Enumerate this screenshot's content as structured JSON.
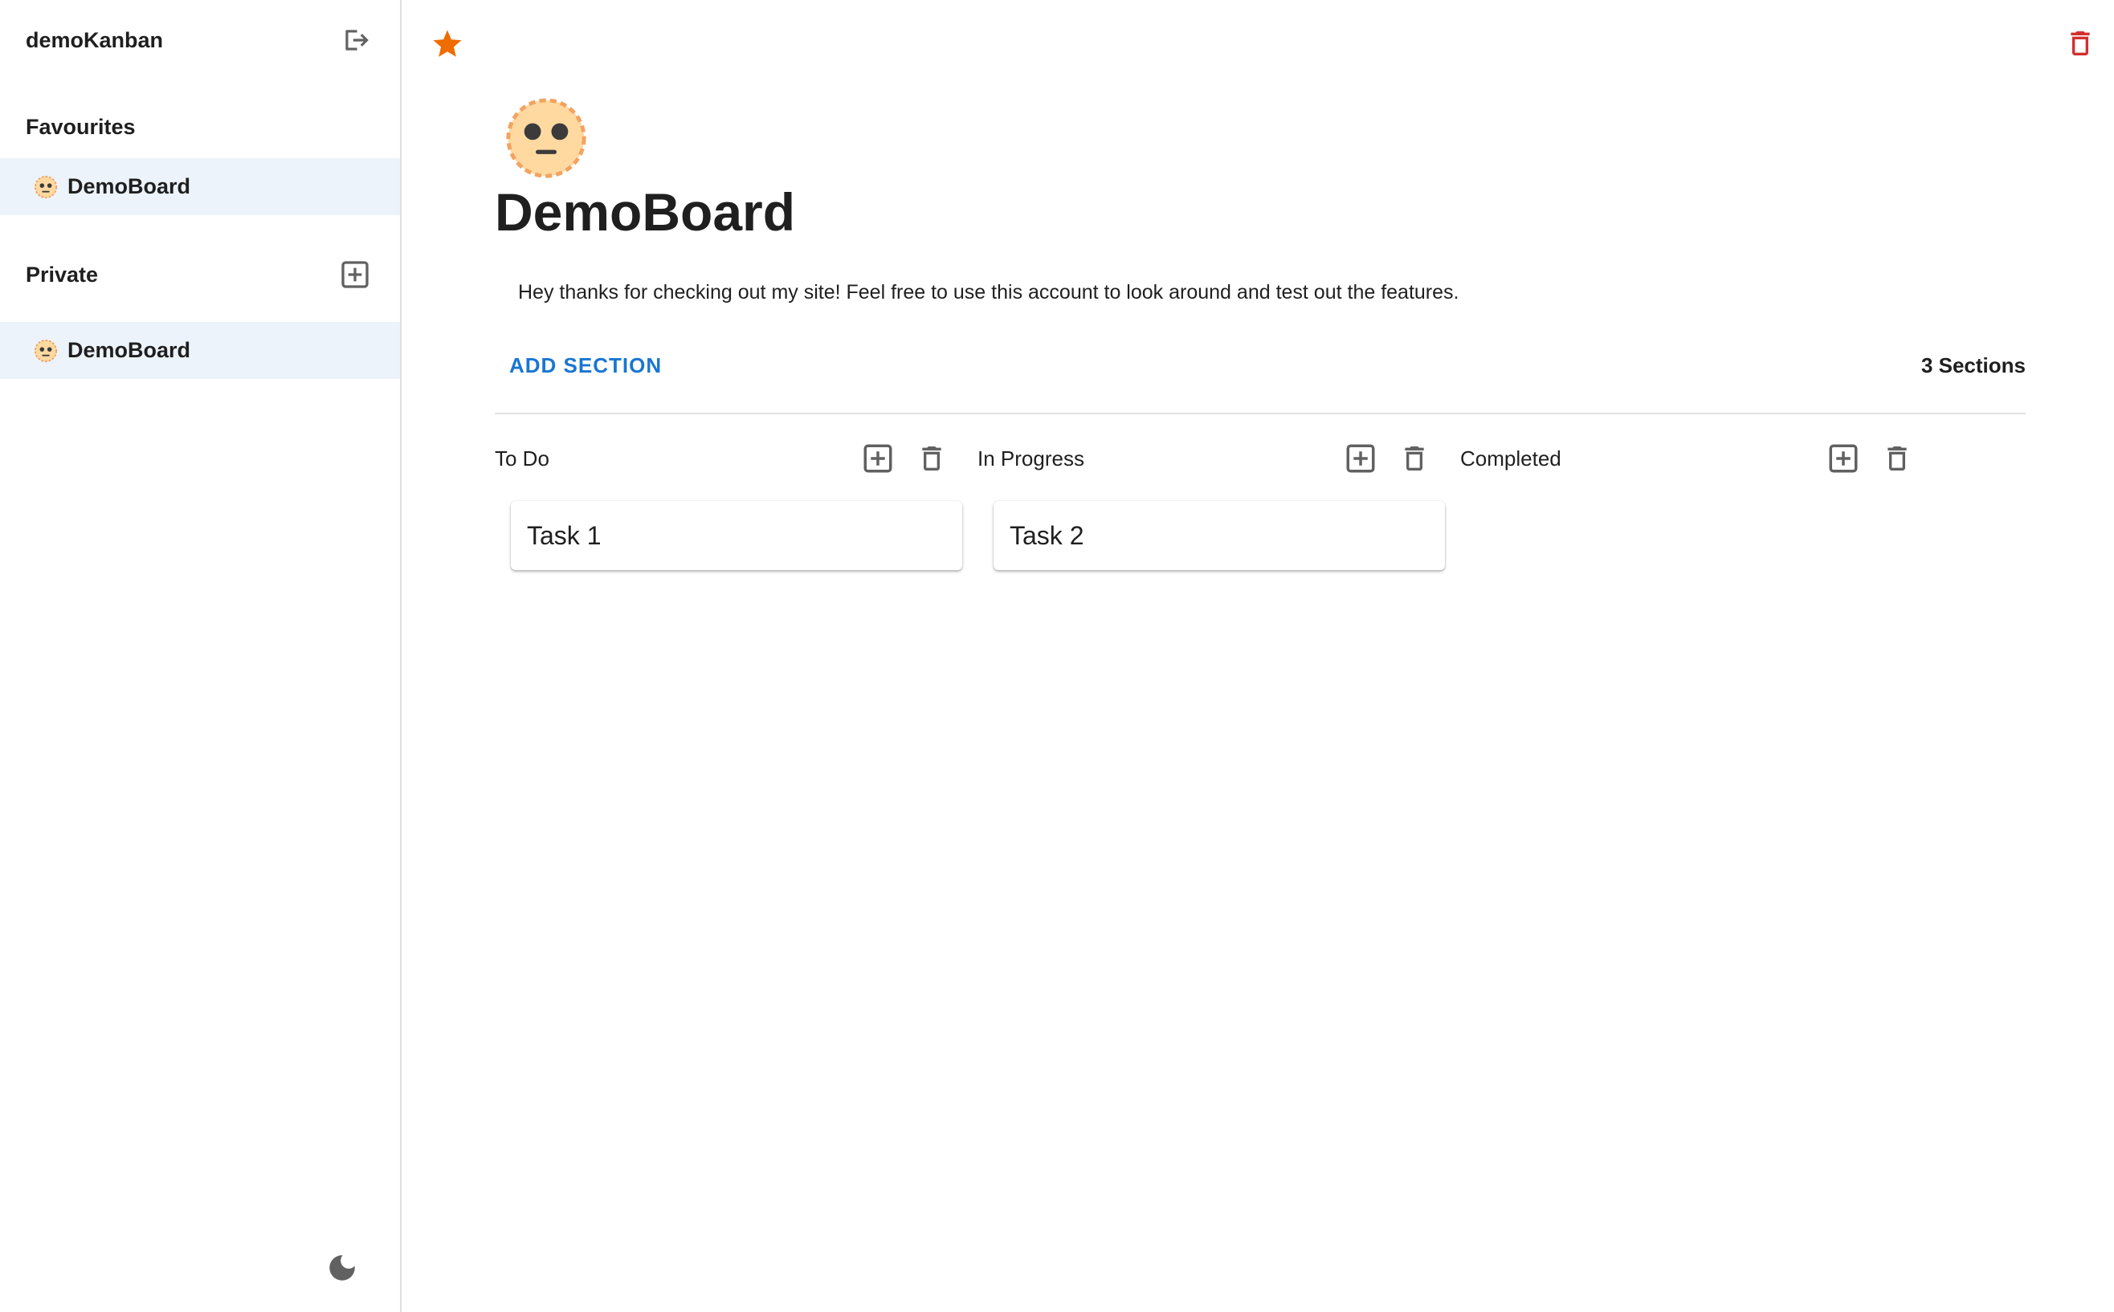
{
  "app": {
    "title": "demoKanban"
  },
  "sidebar": {
    "favourites": {
      "title": "Favourites",
      "items": [
        {
          "label": "DemoBoard",
          "icon": "face-emoji-icon"
        }
      ]
    },
    "private": {
      "title": "Private",
      "items": [
        {
          "label": "DemoBoard",
          "icon": "face-emoji-icon"
        }
      ]
    }
  },
  "board": {
    "title": "DemoBoard",
    "icon": "face-emoji-icon",
    "favourite": true,
    "description": "Hey thanks for checking out my site! Feel free to use this account to look around and test out the features.",
    "add_section_label": "ADD SECTION",
    "section_count_label": "3 Sections",
    "sections": [
      {
        "title": "To Do",
        "tasks": [
          {
            "title": "Task 1"
          }
        ]
      },
      {
        "title": "In Progress",
        "tasks": [
          {
            "title": "Task 2"
          }
        ]
      },
      {
        "title": "Completed",
        "tasks": []
      }
    ]
  },
  "colors": {
    "accent": "#1976d2",
    "star": "#ef6c00",
    "delete": "#d32f2f",
    "selected_bg": "#edf3fb",
    "icon_gray": "#616161"
  }
}
